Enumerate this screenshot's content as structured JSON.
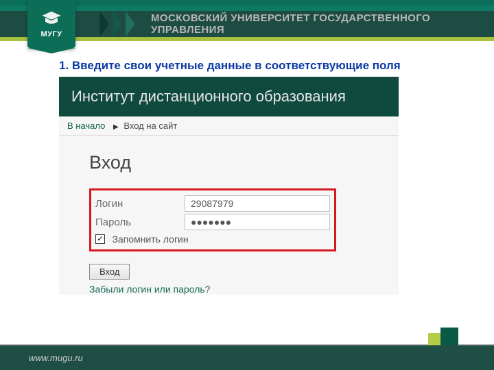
{
  "logo": {
    "text": "МУГУ"
  },
  "header_title": "МОСКОВСКИЙ УНИВЕРСИТЕТ ГОСУДАРСТВЕННОГО УПРАВЛЕНИЯ",
  "instruction": "1. Введите свои учетные данные в соответствующие поля",
  "panel": {
    "title": "Институт дистанционного образования",
    "breadcrumb": {
      "home": "В начало",
      "current": "Вход на сайт"
    },
    "form": {
      "heading": "Вход",
      "login_label": "Логин",
      "login_value": "29087979",
      "password_label": "Пароль",
      "password_value": "●●●●●●●",
      "remember_label": "Запомнить логин",
      "remember_checked": true,
      "submit_label": "Вход",
      "forgot_label": "Забыли логин или пароль?"
    }
  },
  "footer": {
    "url": "www.mugu.ru"
  }
}
